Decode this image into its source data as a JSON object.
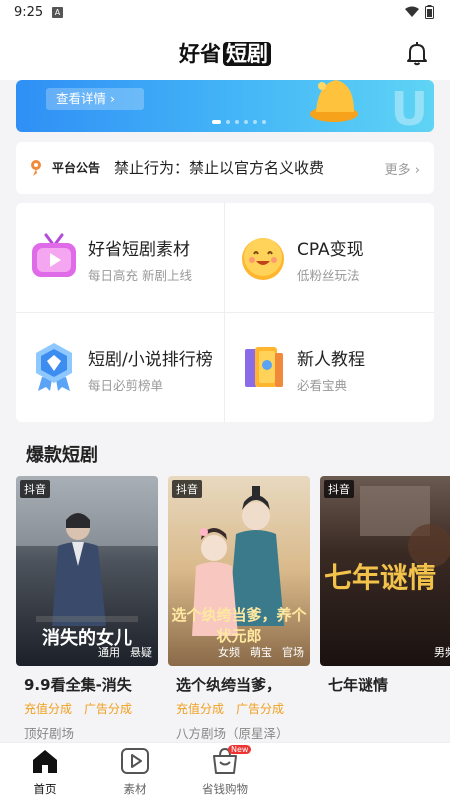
{
  "status_bar": {
    "time": "9:25",
    "notification_letter": "A"
  },
  "header": {
    "title_prefix": "好省",
    "title_highlight": "短剧"
  },
  "banner": {
    "button_label": "查看详情 ›",
    "active_dot": 1,
    "dot_count": 6
  },
  "notice": {
    "label": "平台公告",
    "text": "禁止行为：禁止以官方名义收费",
    "more": "更多 ›"
  },
  "grid": [
    {
      "title": "好省短剧素材",
      "subtitle": "每日高充 新剧上线",
      "icon": "tv-play-icon"
    },
    {
      "title": "CPA变现",
      "subtitle": "低粉丝玩法",
      "icon": "smile-face-icon"
    },
    {
      "title": "短剧/小说排行榜",
      "subtitle": "每日必剪榜单",
      "icon": "diamond-medal-icon"
    },
    {
      "title": "新人教程",
      "subtitle": "必看宝典",
      "icon": "books-icon"
    }
  ],
  "section": {
    "title": "爆款短剧"
  },
  "dramas": [
    {
      "badge": "抖音",
      "tags": [
        "通用",
        "悬疑"
      ],
      "poster_text": "消失的女儿",
      "title": "9.9看全集-消失",
      "benefits": [
        "充值分成",
        "广告分成"
      ],
      "source": "顶好剧场"
    },
    {
      "badge": "抖音",
      "tags": [
        "女频",
        "萌宝",
        "官场"
      ],
      "poster_text": "选个纨绔当爹，养个状元郎",
      "title": "选个纨绔当爹，",
      "benefits": [
        "充值分成",
        "广告分成"
      ],
      "source": "八方剧场（原星泽）"
    },
    {
      "badge": "抖音",
      "tags": [
        "男频"
      ],
      "poster_text": "七年谜情",
      "title": "七年谜情",
      "benefits": [],
      "source": ""
    }
  ],
  "tabbar": [
    {
      "label": "首页",
      "active": true,
      "icon": "home-icon"
    },
    {
      "label": "素材",
      "active": false,
      "icon": "play-icon"
    },
    {
      "label": "省钱购物",
      "active": false,
      "icon": "shopping-bag-icon",
      "badge": "New"
    }
  ],
  "colors": {
    "accent_orange": "#f0a020",
    "banner_blue": "#2f8ff5",
    "text_dark": "#222222"
  }
}
